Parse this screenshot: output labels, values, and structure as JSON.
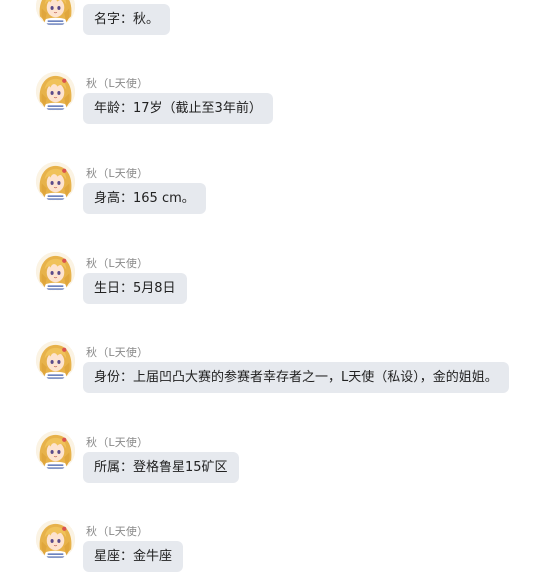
{
  "chat": {
    "messages": [
      {
        "sender": "",
        "text": "名字：秋。"
      },
      {
        "sender": "秋（L天使）",
        "text": "年龄：17岁（截止至3年前）"
      },
      {
        "sender": "秋（L天使）",
        "text": "身高：165 cm。"
      },
      {
        "sender": "秋（L天使）",
        "text": "生日：5月8日"
      },
      {
        "sender": "秋（L天使）",
        "text": "身份：上届凹凸大赛的参赛者幸存者之一，L天使（私设），金的姐姐。"
      },
      {
        "sender": "秋（L天使）",
        "text": "所属：登格鲁星15矿区"
      },
      {
        "sender": "秋（L天使）",
        "text": "星座：金牛座"
      }
    ]
  },
  "colors": {
    "bubble_bg": "#e6e9ee",
    "sender_text": "#8a8a8a",
    "message_text": "#222222"
  },
  "icons": {
    "avatar": "anime-girl-avatar-icon"
  }
}
